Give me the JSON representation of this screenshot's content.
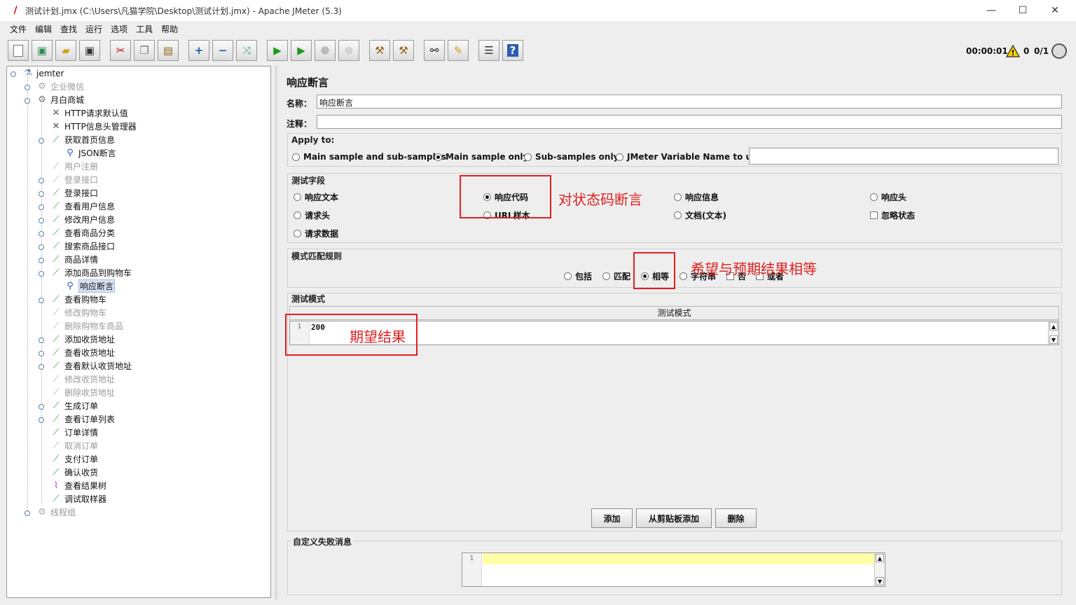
{
  "window": {
    "title": "测试计划.jmx (C:\\Users\\凡猫学院\\Desktop\\测试计划.jmx) - Apache JMeter (5.3)",
    "min": "—",
    "max": "☐",
    "close": "✕"
  },
  "menu": [
    "文件",
    "编辑",
    "查找",
    "运行",
    "选项",
    "工具",
    "帮助"
  ],
  "toolbar": {
    "timer": "00:00:01",
    "warnings": "0",
    "threads": "0/1"
  },
  "tree": [
    {
      "label": "jemter",
      "icon": "flask-icon",
      "disabled": false
    },
    {
      "label": "企业微信",
      "icon": "gear-icon",
      "disabled": true
    },
    {
      "label": "月白商城",
      "icon": "gear-icon",
      "disabled": false
    },
    {
      "label": "HTTP请求默认值",
      "icon": "wrench-icon",
      "disabled": false
    },
    {
      "label": "HTTP信息头管理器",
      "icon": "wrench-icon",
      "disabled": false
    },
    {
      "label": "获取首页信息",
      "icon": "pipette-icon",
      "disabled": false
    },
    {
      "label": "JSON断言",
      "icon": "magnifier-icon",
      "disabled": false
    },
    {
      "label": "用户注册",
      "icon": "pipette-icon",
      "disabled": true
    },
    {
      "label": "登录接口",
      "icon": "pipette-icon",
      "disabled": true
    },
    {
      "label": "登录接口",
      "icon": "pipette-icon",
      "disabled": false
    },
    {
      "label": "查看用户信息",
      "icon": "pipette-icon",
      "disabled": false
    },
    {
      "label": "修改用户信息",
      "icon": "pipette-icon",
      "disabled": false
    },
    {
      "label": "查看商品分类",
      "icon": "pipette-icon",
      "disabled": false
    },
    {
      "label": "搜索商品接口",
      "icon": "pipette-icon",
      "disabled": false
    },
    {
      "label": "商品详情",
      "icon": "pipette-icon",
      "disabled": false
    },
    {
      "label": "添加商品到购物车",
      "icon": "pipette-icon",
      "disabled": false
    },
    {
      "label": "响应断言",
      "icon": "magnifier-icon",
      "disabled": false
    },
    {
      "label": "查看购物车",
      "icon": "pipette-icon",
      "disabled": false
    },
    {
      "label": "修改购物车",
      "icon": "pipette-icon",
      "disabled": true
    },
    {
      "label": "删除购物车商品",
      "icon": "pipette-icon",
      "disabled": true
    },
    {
      "label": "添加收货地址",
      "icon": "pipette-icon",
      "disabled": false
    },
    {
      "label": "查看收货地址",
      "icon": "pipette-icon",
      "disabled": false
    },
    {
      "label": "查看默认收货地址",
      "icon": "pipette-icon",
      "disabled": false
    },
    {
      "label": "修改收货地址",
      "icon": "pipette-icon",
      "disabled": true
    },
    {
      "label": "删除收货地址",
      "icon": "pipette-icon",
      "disabled": true
    },
    {
      "label": "生成订单",
      "icon": "pipette-icon",
      "disabled": false
    },
    {
      "label": "查看订单列表",
      "icon": "pipette-icon",
      "disabled": false
    },
    {
      "label": "订单详情",
      "icon": "pipette-icon",
      "disabled": false
    },
    {
      "label": "取消订单",
      "icon": "pipette-icon",
      "disabled": true
    },
    {
      "label": "支付订单",
      "icon": "pipette-icon",
      "disabled": false
    },
    {
      "label": "确认收货",
      "icon": "pipette-icon",
      "disabled": false
    },
    {
      "label": "查看结果树",
      "icon": "graph-icon",
      "disabled": false
    },
    {
      "label": "调试取样器",
      "icon": "pipette-icon",
      "disabled": false
    },
    {
      "label": "线程组",
      "icon": "gear-icon",
      "disabled": true
    }
  ],
  "panel": {
    "title": "响应断言",
    "name_label": "名称：",
    "name_value": "响应断言",
    "comment_label": "注释：",
    "comment_value": "",
    "apply_to": {
      "title": "Apply to:",
      "options": [
        "Main sample and sub-samples",
        "Main sample only",
        "Sub-samples only",
        "JMeter Variable Name to use"
      ],
      "selected": "Main sample only",
      "variable_value": ""
    },
    "test_field": {
      "title": "测试字段",
      "options": [
        "响应文本",
        "响应代码",
        "响应信息",
        "响应头",
        "请求头",
        "URL样本",
        "文档(文本)",
        "请求数据"
      ],
      "selected": "响应代码",
      "ignore_status": "忽略状态"
    },
    "pattern_rules": {
      "title": "模式匹配规则",
      "options": [
        "包括",
        "匹配",
        "相等",
        "字符串"
      ],
      "selected": "相等",
      "not": "否",
      "or": "或者"
    },
    "test_patterns": {
      "title": "测试模式",
      "header": "测试模式",
      "line_no": "1",
      "value": "200"
    },
    "buttons": {
      "add": "添加",
      "add_clipboard": "从剪贴板添加",
      "delete": "删除"
    },
    "custom_failure": {
      "title": "自定义失败消息",
      "line_no": "1",
      "value": ""
    }
  },
  "annotations": {
    "status_code": "对状态码断言",
    "equal": "希望与预期结果相等",
    "expected": "期望结果"
  },
  "colors": {
    "annotation": "#e02020",
    "selection": "#d6e2f4",
    "highlight_line": "#ffffaa"
  }
}
